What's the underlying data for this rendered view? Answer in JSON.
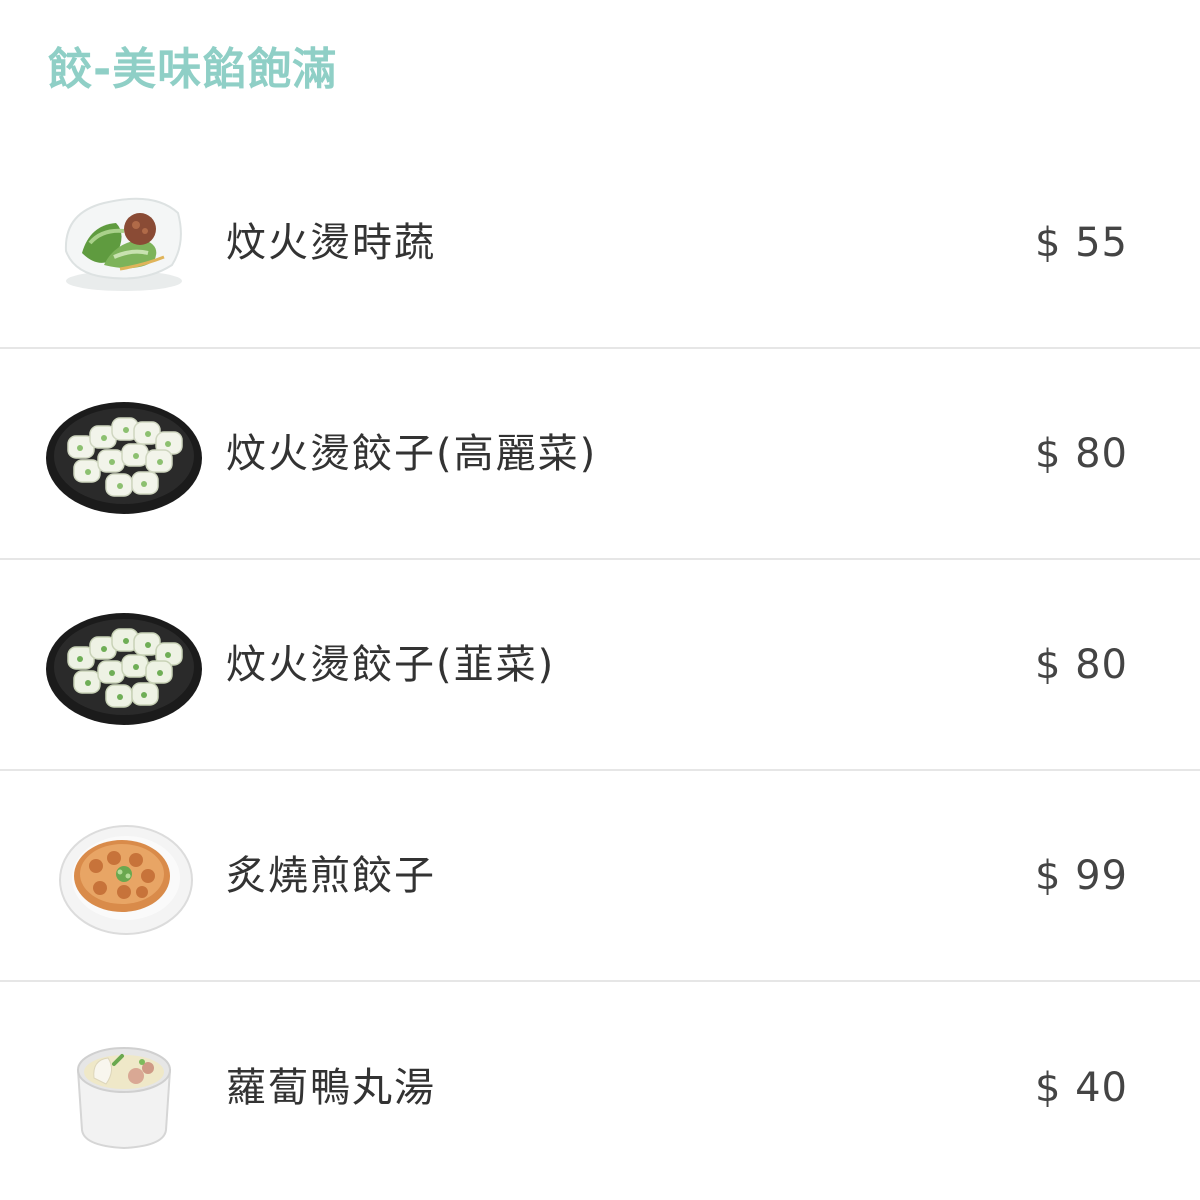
{
  "section": {
    "title": "餃-美味餡飽滿",
    "accent_color": "#8fcfc6"
  },
  "items": [
    {
      "name": "炆火燙時蔬",
      "price": "$ 55",
      "image_icon": "blanched-greens-dish-icon"
    },
    {
      "name": "炆火燙餃子(高麗菜)",
      "price": "$ 80",
      "image_icon": "boiled-dumplings-plate-icon"
    },
    {
      "name": "炆火燙餃子(韮菜)",
      "price": "$ 80",
      "image_icon": "boiled-dumplings-plate-icon"
    },
    {
      "name": "炙燒煎餃子",
      "price": "$ 99",
      "image_icon": "pan-fried-dumplings-plate-icon"
    },
    {
      "name": "蘿蔔鴨丸湯",
      "price": "$ 40",
      "image_icon": "radish-duck-ball-soup-icon"
    }
  ]
}
